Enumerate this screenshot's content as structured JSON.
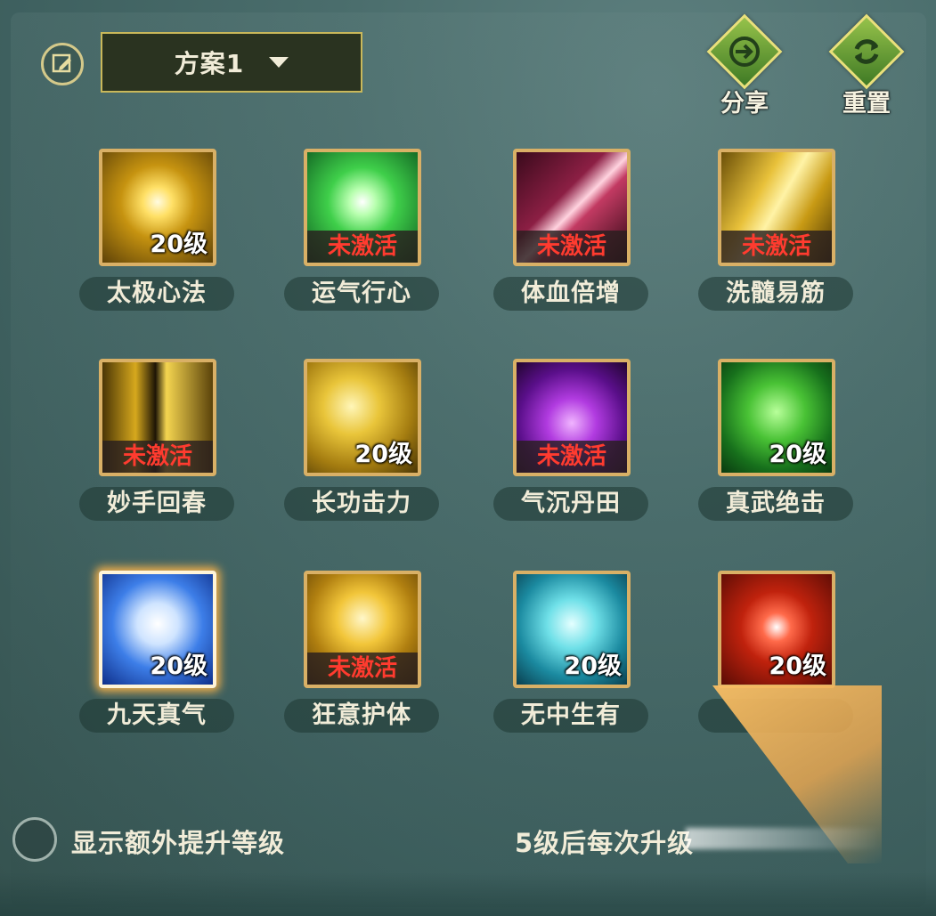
{
  "header": {
    "scheme_label": "方案1",
    "share_label": "分享",
    "reset_label": "重置"
  },
  "skills": [
    {
      "name": "太极心法",
      "status": "20级",
      "active": true
    },
    {
      "name": "运气行心",
      "status": "未激活",
      "active": false
    },
    {
      "name": "体血倍增",
      "status": "未激活",
      "active": false
    },
    {
      "name": "洗髓易筋",
      "status": "未激活",
      "active": false
    },
    {
      "name": "妙手回春",
      "status": "未激活",
      "active": false
    },
    {
      "name": "长功击力",
      "status": "20级",
      "active": true
    },
    {
      "name": "气沉丹田",
      "status": "未激活",
      "active": false
    },
    {
      "name": "真武绝击",
      "status": "20级",
      "active": true
    },
    {
      "name": "九天真气",
      "status": "20级",
      "active": true,
      "selected": true
    },
    {
      "name": "狂意护体",
      "status": "未激活",
      "active": false
    },
    {
      "name": "无中生有",
      "status": "20级",
      "active": true
    },
    {
      "name": "",
      "status": "20级",
      "active": true
    }
  ],
  "footer": {
    "toggle_label": "显示额外提升等级",
    "note": "5级后每次升级"
  },
  "colors": {
    "frame_gold": "#d9b066",
    "inactive_red": "#ff3b2f",
    "button_green": "#6fa33a"
  }
}
